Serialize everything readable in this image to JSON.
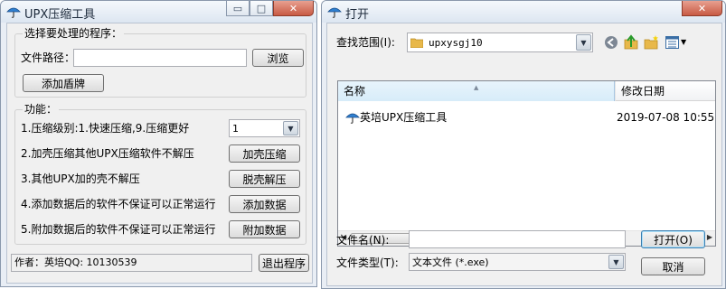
{
  "upx_window": {
    "title": "UPX压缩工具",
    "controls": {
      "minimize": "▭",
      "maximize": "□",
      "close": "✕"
    },
    "select_group": {
      "legend": "选择要处理的程序：",
      "path_label": "文件路径：",
      "path_value": "",
      "browse_button": "浏览",
      "add_shield_button": "添加盾牌"
    },
    "function_group": {
      "legend": "功能：",
      "rows": [
        {
          "text": "1.压缩级别:1.快速压缩,9.压缩更好"
        },
        {
          "text": "2.加壳压缩其他UPX压缩软件不解压",
          "button": "加壳压缩"
        },
        {
          "text": "3.其他UPX加的壳不解压",
          "button": "脱壳解压"
        },
        {
          "text": "4.添加数据后的软件不保证可以正常运行",
          "button": "添加数据"
        },
        {
          "text": "5.附加数据后的软件不保证可以正常运行",
          "button": "附加数据"
        }
      ],
      "level_value": "1"
    },
    "author_text": "作者：英培QQ: 10130539",
    "exit_button": "退出程序"
  },
  "open_dialog": {
    "title": "打开",
    "close_label": "✕",
    "lookin_label": "查找范围(I):",
    "lookin_value": "upxysgj10",
    "columns": {
      "name": "名称",
      "date": "修改日期"
    },
    "files": [
      {
        "name": "英培UPX压缩工具",
        "date": "2019-07-08 10:55"
      }
    ],
    "filename_label": "文件名(N):",
    "filename_value": "",
    "filetype_label": "文件类型(T):",
    "filetype_value": "文本文件 (*.exe)",
    "open_button": "打开(O)",
    "cancel_button": "取消"
  },
  "icons": {
    "app": "umbrella-icon",
    "folder": "folder-icon",
    "back": "back-arrow-icon",
    "up": "up-folder-icon",
    "new_folder": "new-folder-icon",
    "views": "views-menu-icon"
  },
  "colors": {
    "title_text": "#1e2b3c",
    "window_border": "#8a98ac",
    "close_button": "#c85a44"
  }
}
